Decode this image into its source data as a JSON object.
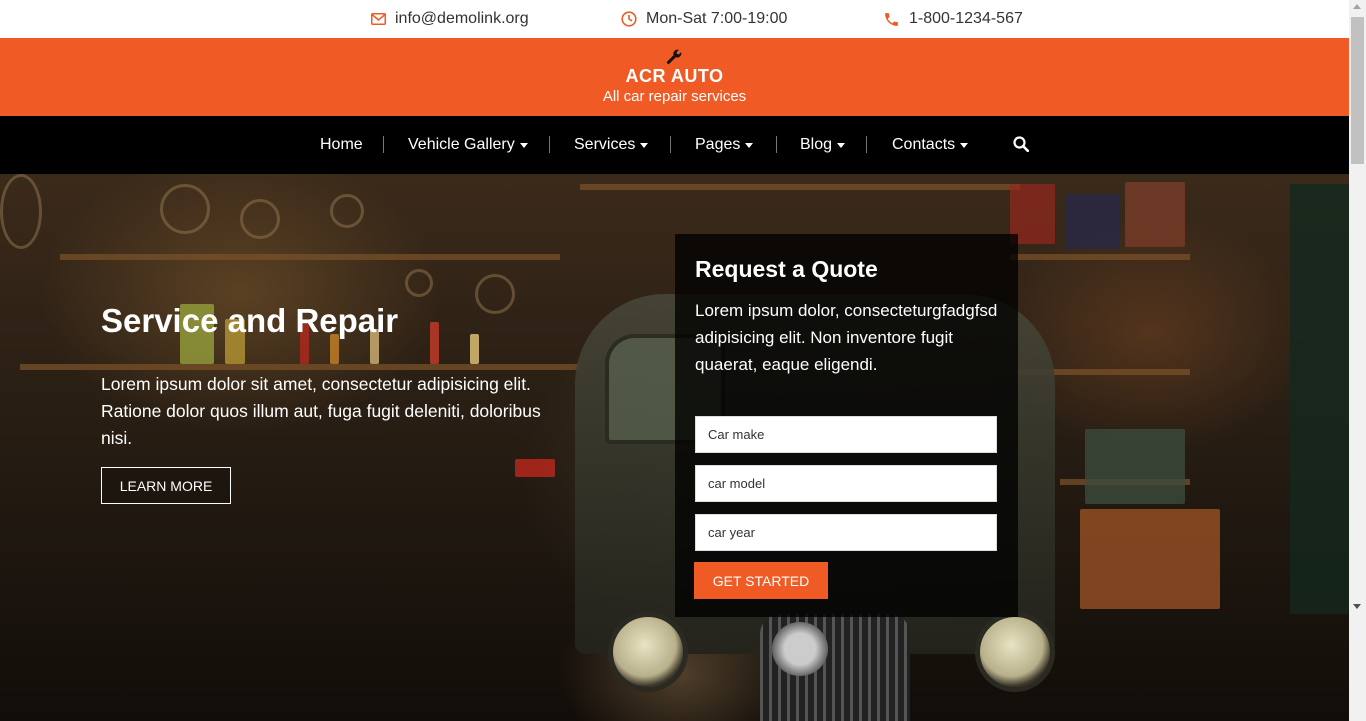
{
  "topbar": {
    "email": "info@demolink.org",
    "hours": "Mon-Sat 7:00-19:00",
    "phone": "1-800-1234-567"
  },
  "brand": {
    "title": "ACR AUTO",
    "tagline": "All car repair services",
    "logo_icon": "wrench-icon"
  },
  "nav": {
    "items": [
      {
        "label": "Home",
        "dropdown": false
      },
      {
        "label": "Vehicle Gallery",
        "dropdown": true
      },
      {
        "label": "Services",
        "dropdown": true
      },
      {
        "label": "Pages",
        "dropdown": true
      },
      {
        "label": "Blog",
        "dropdown": true
      },
      {
        "label": "Contacts",
        "dropdown": true
      }
    ],
    "search_icon": "search-icon"
  },
  "hero": {
    "title": "Service and Repair",
    "text": "Lorem ipsum dolor sit amet, consectetur adipisicing elit. Ratione dolor quos illum aut, fuga fugit deleniti, doloribus nisi.",
    "button_label": "LEARN MORE"
  },
  "quote": {
    "title": "Request a Quote",
    "text": "Lorem ipsum dolor, consecteturgfadgfsd adipisicing elit. Non inventore fugit quaerat, eaque eligendi.",
    "fields": [
      {
        "placeholder": "Car make",
        "value": ""
      },
      {
        "placeholder": "car model",
        "value": ""
      },
      {
        "placeholder": "car year",
        "value": ""
      }
    ],
    "button_label": "GET STARTED"
  },
  "colors": {
    "accent": "#f05a24",
    "nav_bg": "#000000",
    "text_dark": "#333333"
  }
}
